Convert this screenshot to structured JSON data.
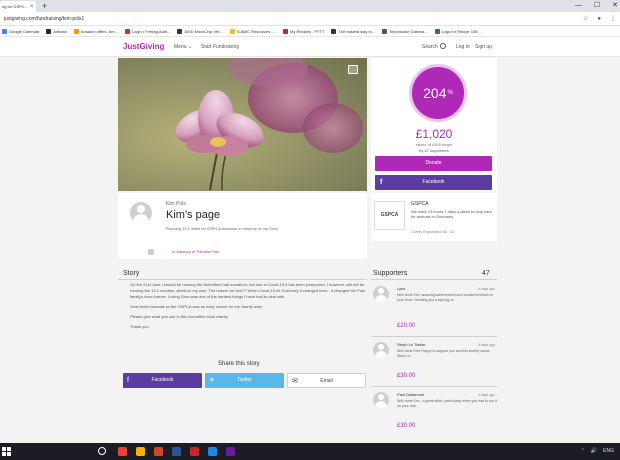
{
  "browser": {
    "tab_title": "ng for GSPC...",
    "tab_close": "×",
    "new_tab": "+",
    "url": "justgiving.com/fundraising/kim-pols1",
    "window_minimize": "—",
    "window_maximize": "☐",
    "window_close": "✕",
    "bookmarks": [
      {
        "label": "Google Calendar",
        "color": "#4285f4"
      },
      {
        "label": "Airbase",
        "color": "#2b2b2b"
      },
      {
        "label": "Amazon offers, Am...",
        "color": "#ff9900"
      },
      {
        "label": "Login • Frettag Auth...",
        "color": "#d93025"
      },
      {
        "label": "AVID MicroChip Vet...",
        "color": "#333333"
      },
      {
        "label": "ICAWC Resources -...",
        "color": "#f4c20d"
      },
      {
        "label": "My Recipes - PTTT",
        "color": "#c62828"
      },
      {
        "label": "The easiest way to...",
        "color": "#333333"
      },
      {
        "label": "Technicolor Gatewa...",
        "color": "#555555"
      },
      {
        "label": "Logs for Recipe 155...",
        "color": "#2e7d32"
      }
    ]
  },
  "header": {
    "logo": "JustGiving",
    "menu": "Menu ⌄",
    "start": "Start Fundraising",
    "search": "Search",
    "login": "Log in",
    "signup": "Sign up"
  },
  "fundraising": {
    "percent": "204",
    "percent_sign": "%",
    "raised": "£1,020",
    "target": "raised of £500 target",
    "supporters_line": "by 47 supporters",
    "donate": "Donate",
    "facebook": "Facebook",
    "facebook_icon": "f"
  },
  "page": {
    "owner": "Kim Pols",
    "title": "Kim's page",
    "description": "Running 13.1 miles for GSPCA because in memory of my Gran",
    "memory": "In Memory of Pamela Pols"
  },
  "charity": {
    "logo": "GSPCA",
    "name": "GSPCA",
    "description": "We work 24 hours 7 days a week to help care for animals in Guernsey",
    "registration": "Charity Registration No. 102"
  },
  "story": {
    "heading": "Story",
    "paragraphs": [
      "On the 21st June I should be running the Butterfield half marathon, but due to Covid-19 it has been postponed. I however, will still be running the 13.1 courses, albeit on my own. The reason for this?? When Covid-19 hit Guernsey it changed lives.. It changed the Pols family's lives forever. Losing Gran was one of the hardest things I have had to deal with.",
      "Gran loved animals so the GSPCA was an easy choice for me charity wise.",
      "Please give what you can to this incredible local charity.",
      "Thank you"
    ]
  },
  "share": {
    "title": "Share this story",
    "facebook": "Facebook",
    "twitter": "Twitter",
    "email": "Email"
  },
  "supporters": {
    "heading": "Supporters",
    "count": "47",
    "items": [
      {
        "name": "Lyns",
        "time": "4 days ago",
        "message": "Well done Kim, amazing achievement and wonderful tribute to your Gran. Sending you a big hug xx",
        "amount": "£20.00"
      },
      {
        "name": "Steph Le Tissier",
        "time": "4 days ago",
        "message": "Well done Kim! Happy to support you and this worthy cause Steph xx",
        "amount": "£30.00"
      },
      {
        "name": "Paul Dallamore",
        "time": "4 days ago",
        "message": "Well done Kim - a great effort, particularly when you had to run it on your own.",
        "amount": "£30.00"
      }
    ]
  },
  "taskbar": {
    "tray": [
      "⌃",
      "🔊",
      "ENG"
    ]
  }
}
